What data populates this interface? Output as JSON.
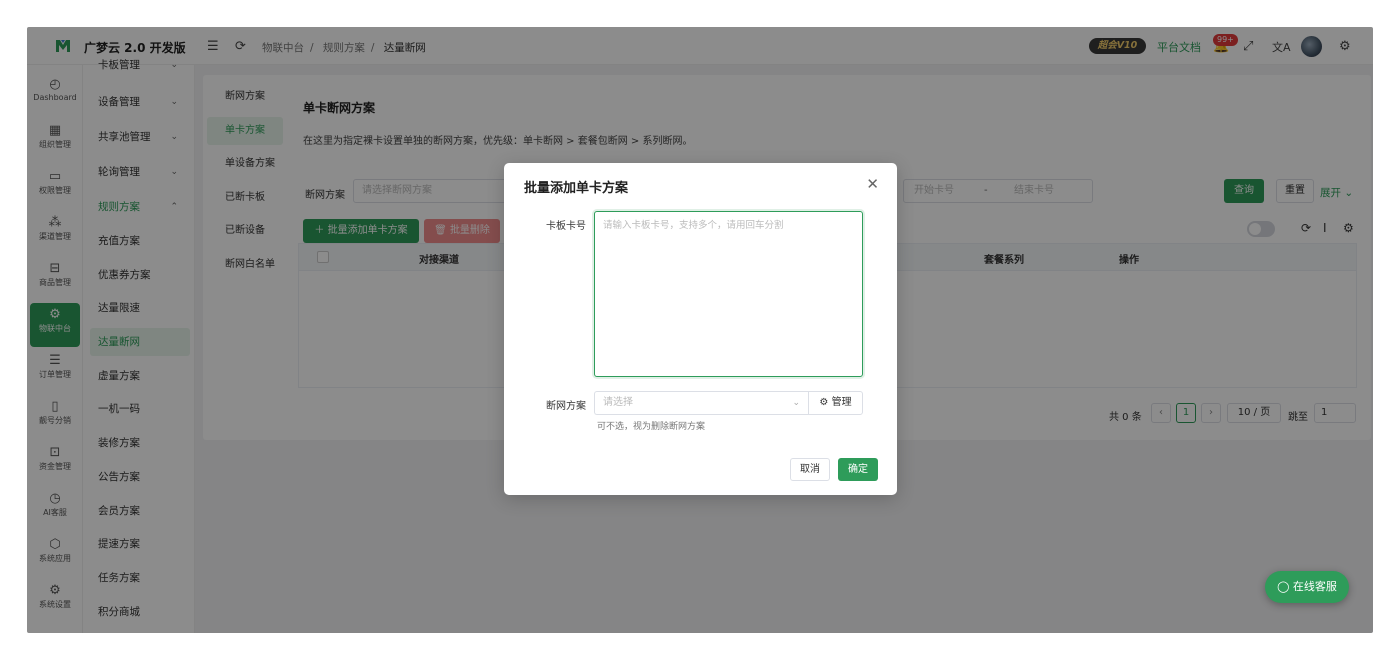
{
  "brand": "广梦云 2.0 开发版",
  "breadcrumb": [
    "物联中台",
    "规则方案",
    "达量断网"
  ],
  "header": {
    "vip": "超会V10",
    "docs": "平台文档",
    "badge": "99+"
  },
  "rail": [
    {
      "label": "Dashboard",
      "icon": "dashboard-icon"
    },
    {
      "label": "组织管理",
      "icon": "grid-icon"
    },
    {
      "label": "权限管理",
      "icon": "monitor-icon"
    },
    {
      "label": "渠道管理",
      "icon": "network-icon"
    },
    {
      "label": "商品管理",
      "icon": "shop-icon"
    },
    {
      "label": "物联中台",
      "icon": "iot-icon"
    },
    {
      "label": "订单管理",
      "icon": "list-icon"
    },
    {
      "label": "靓号分销",
      "icon": "phone-icon"
    },
    {
      "label": "资金管理",
      "icon": "money-icon"
    },
    {
      "label": "AI客服",
      "icon": "ai-icon"
    },
    {
      "label": "系统应用",
      "icon": "app-icon"
    },
    {
      "label": "系统设置",
      "icon": "gear-icon"
    }
  ],
  "submenu": [
    "卡板管理",
    "设备管理",
    "共享池管理",
    "轮询管理",
    "规则方案",
    "充值方案",
    "优惠券方案",
    "达量限速",
    "达量断网",
    "虚量方案",
    "一机一码",
    "装修方案",
    "公告方案",
    "会员方案",
    "提速方案",
    "任务方案",
    "积分商城"
  ],
  "tabs": [
    "断网方案",
    "单卡方案",
    "单设备方案",
    "已断卡板",
    "已断设备",
    "断网白名单"
  ],
  "main": {
    "title": "单卡断网方案",
    "desc": "在这里为指定裸卡设置单独的断网方案，优先级：单卡断网 > 套餐包断网 > 系列断网。",
    "filter_label": "断网方案",
    "filter_placeholder": "请选择断网方案",
    "range_start": "开始卡号",
    "range_sep": "-",
    "range_end": "结束卡号",
    "query": "查询",
    "reset": "重置",
    "expand": "展开",
    "batch_add": "批量添加单卡方案",
    "batch_delete": "批量删除",
    "columns": [
      "对接渠道",
      "套餐系列",
      "操作"
    ],
    "pager": {
      "total": "共 0 条",
      "page": "1",
      "size": "10 / 页",
      "jump": "跳至",
      "jump_value": "1"
    }
  },
  "dialog": {
    "title": "批量添加单卡方案",
    "card_label": "卡板卡号",
    "card_placeholder": "请输入卡板卡号，支持多个，请用回车分割",
    "plan_label": "断网方案",
    "plan_placeholder": "请选择",
    "manage": "管理",
    "hint": "可不选，视为删除断网方案",
    "cancel": "取消",
    "ok": "确定"
  },
  "chat": "在线客服",
  "colors": {
    "accent": "#2e9c5a",
    "danger": "#f08c8c"
  }
}
